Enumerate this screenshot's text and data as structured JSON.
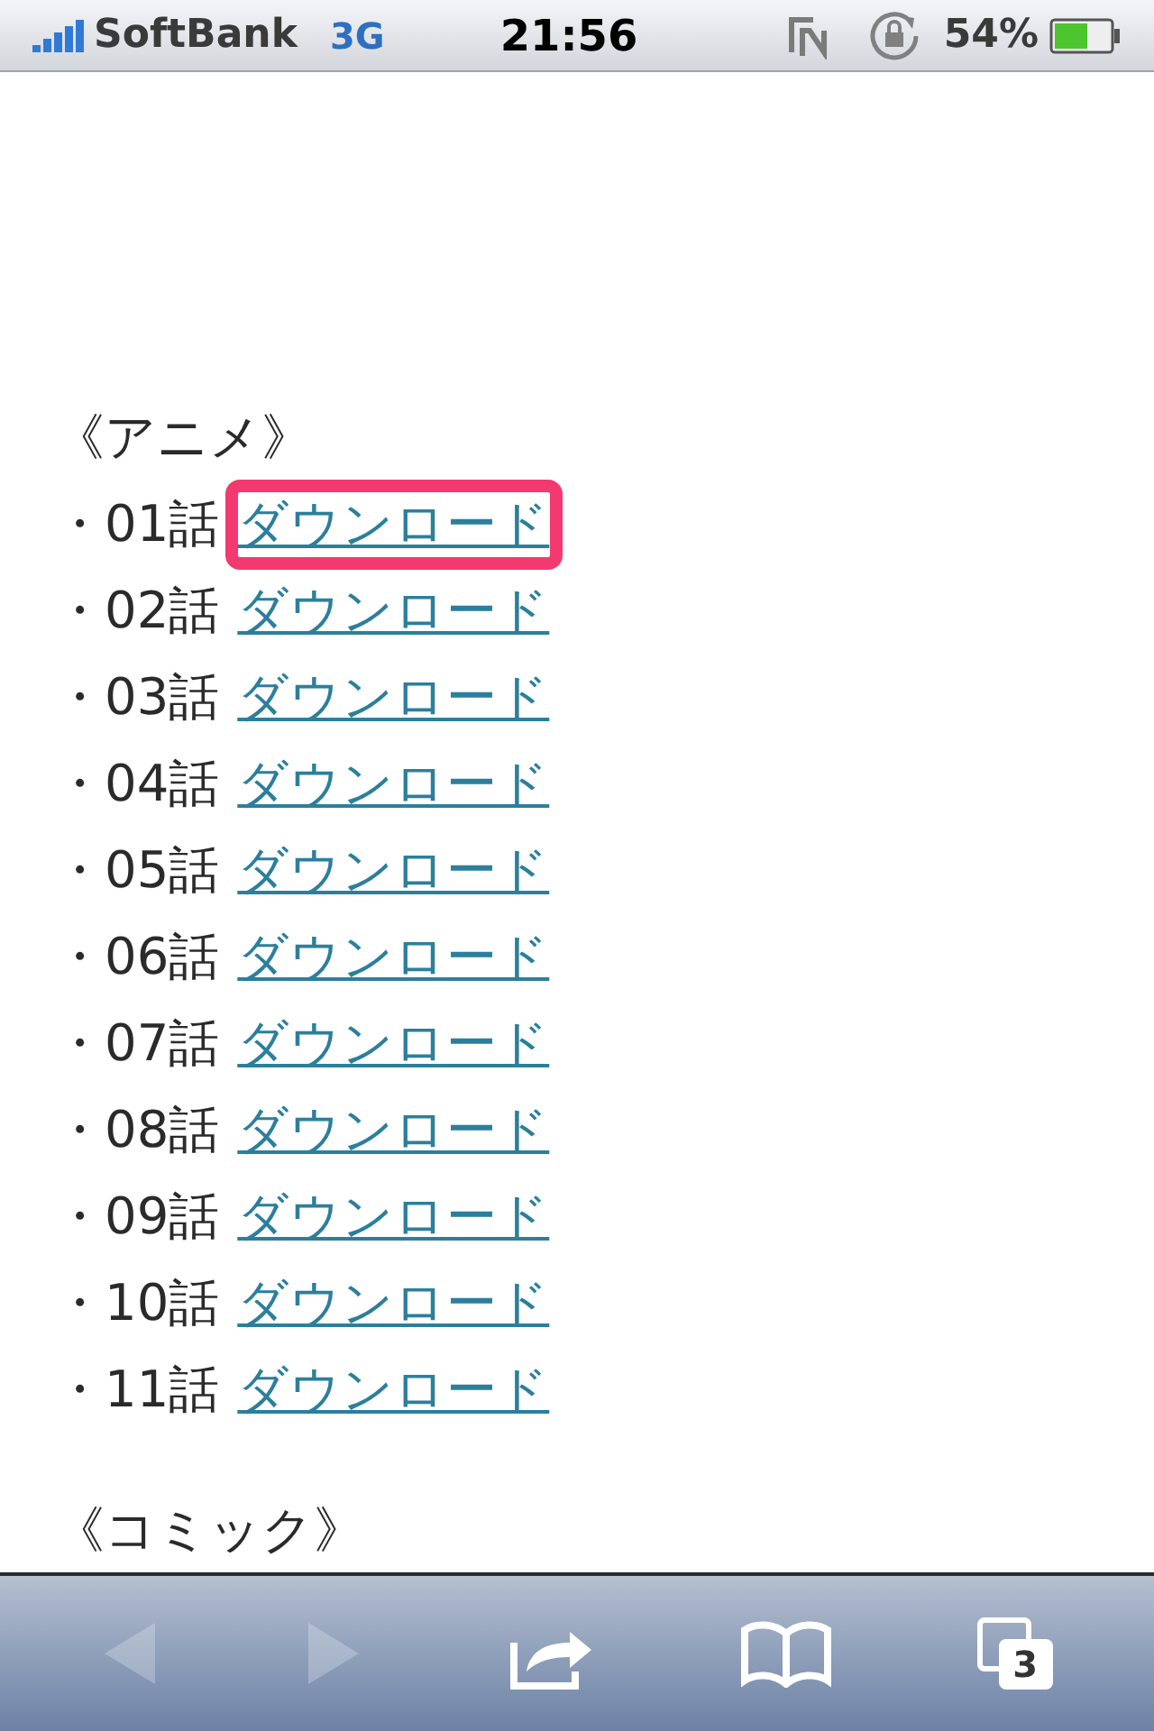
{
  "status_bar": {
    "carrier": "SoftBank",
    "network": "3G",
    "time": "21:56",
    "battery": "54%"
  },
  "sections": [
    {
      "heading": "《アニメ》",
      "items": [
        {
          "label": "・01話",
          "link": "ダウンロード",
          "highlighted": true
        },
        {
          "label": "・02話",
          "link": "ダウンロード",
          "highlighted": false
        },
        {
          "label": "・03話",
          "link": "ダウンロード",
          "highlighted": false
        },
        {
          "label": "・04話",
          "link": "ダウンロード",
          "highlighted": false
        },
        {
          "label": "・05話",
          "link": "ダウンロード",
          "highlighted": false
        },
        {
          "label": "・06話",
          "link": "ダウンロード",
          "highlighted": false
        },
        {
          "label": "・07話",
          "link": "ダウンロード",
          "highlighted": false
        },
        {
          "label": "・08話",
          "link": "ダウンロード",
          "highlighted": false
        },
        {
          "label": "・09話",
          "link": "ダウンロード",
          "highlighted": false
        },
        {
          "label": "・10話",
          "link": "ダウンロード",
          "highlighted": false
        },
        {
          "label": "・11話",
          "link": "ダウンロード",
          "highlighted": false
        }
      ]
    },
    {
      "heading": "《コミック》"
    }
  ],
  "toolbar": {
    "back_disabled": true,
    "forward_disabled": true,
    "tab_count": "3"
  }
}
